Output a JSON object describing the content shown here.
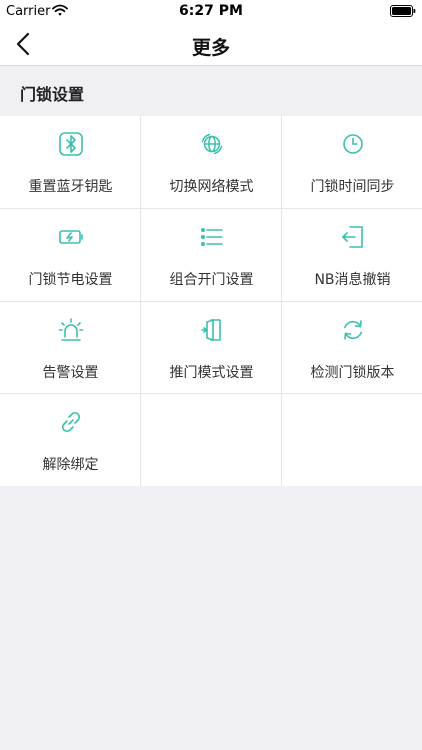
{
  "status_bar": {
    "carrier": "Carrier",
    "time": "6:27 PM",
    "wifi_icon": "wifi-icon",
    "battery_icon": "battery-icon"
  },
  "nav": {
    "back_icon": "chevron-left-icon",
    "title": "更多"
  },
  "section": {
    "title": "门锁设置"
  },
  "accent_color": "#3cc0ad",
  "grid_items": [
    {
      "label": "重置蓝牙钥匙",
      "icon": "bluetooth-icon"
    },
    {
      "label": "切换网络模式",
      "icon": "globe-icon"
    },
    {
      "label": "门锁时间同步",
      "icon": "clock-icon"
    },
    {
      "label": "门锁节电设置",
      "icon": "battery-charging-icon"
    },
    {
      "label": "组合开门设置",
      "icon": "list-icon"
    },
    {
      "label": "NB消息撤销",
      "icon": "exit-icon"
    },
    {
      "label": "告警设置",
      "icon": "alarm-light-icon"
    },
    {
      "label": "推门模式设置",
      "icon": "door-icon"
    },
    {
      "label": "检测门锁版本",
      "icon": "refresh-icon"
    },
    {
      "label": "解除绑定",
      "icon": "unlink-icon"
    }
  ]
}
